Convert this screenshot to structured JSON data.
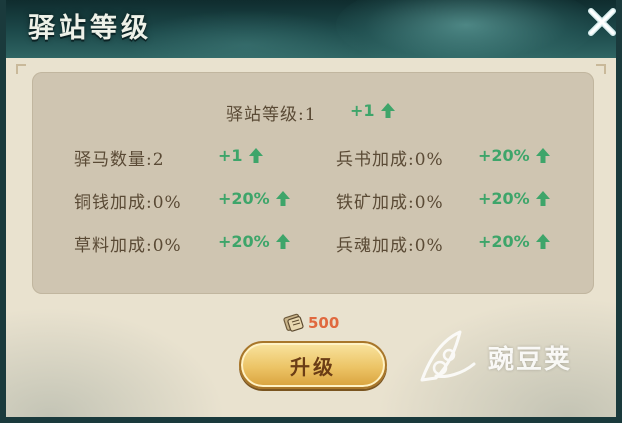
{
  "window": {
    "title": "驿站等级"
  },
  "station_level": {
    "label": "驿站等级:1",
    "bonus": "+1"
  },
  "stats": [
    {
      "label": "驿马数量:2",
      "bonus": "+1"
    },
    {
      "label": "兵书加成:0%",
      "bonus": "+20%"
    },
    {
      "label": "铜钱加成:0%",
      "bonus": "+20%"
    },
    {
      "label": "铁矿加成:0%",
      "bonus": "+20%"
    },
    {
      "label": "草料加成:0%",
      "bonus": "+20%"
    },
    {
      "label": "兵魂加成:0%",
      "bonus": "+20%"
    }
  ],
  "cost": {
    "icon": "scroll-icon",
    "value": "500"
  },
  "upgrade_button": {
    "label": "升级"
  },
  "watermark": {
    "text": "豌豆荚"
  },
  "colors": {
    "bonus_green": "#3ea56a",
    "cost_orange": "#e0693f",
    "label_brown": "#5a4a35",
    "panel_bg": "#cfc5b1",
    "button_gold": "#ecc466"
  }
}
